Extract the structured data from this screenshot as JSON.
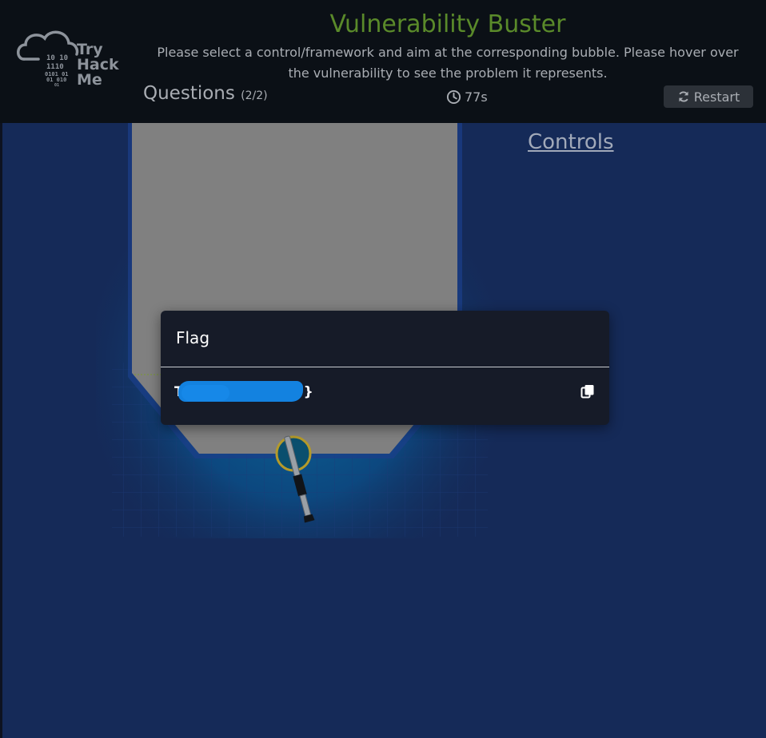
{
  "header": {
    "logo": {
      "brand_lines": [
        "Try",
        "Hack",
        "Me"
      ],
      "binary_lines": [
        "10  10",
        "1110",
        "0101  01",
        "01  010",
        "01"
      ]
    },
    "title": "Vulnerability Buster",
    "subtitle_line1": "Please select a control/framework and aim at the corresponding bubble. Please hover over",
    "subtitle_line2": "the vulnerability to see the problem it represents.",
    "questions_label": "Questions",
    "questions_count": "(2/2)",
    "timer": "77s",
    "restart_label": "Restart"
  },
  "game": {
    "controls_label": "Controls"
  },
  "modal": {
    "title": "Flag",
    "flag_prefix": "T",
    "flag_suffix": "}"
  },
  "colors": {
    "title_green": "#5a8a2a",
    "background_blue": "#152a58",
    "header_bg": "#0b1016",
    "modal_bg": "#161b28",
    "redaction_blue": "#1382e0"
  },
  "icons": [
    "cloud-logo-icon",
    "clock-icon",
    "refresh-icon",
    "copy-icon"
  ]
}
